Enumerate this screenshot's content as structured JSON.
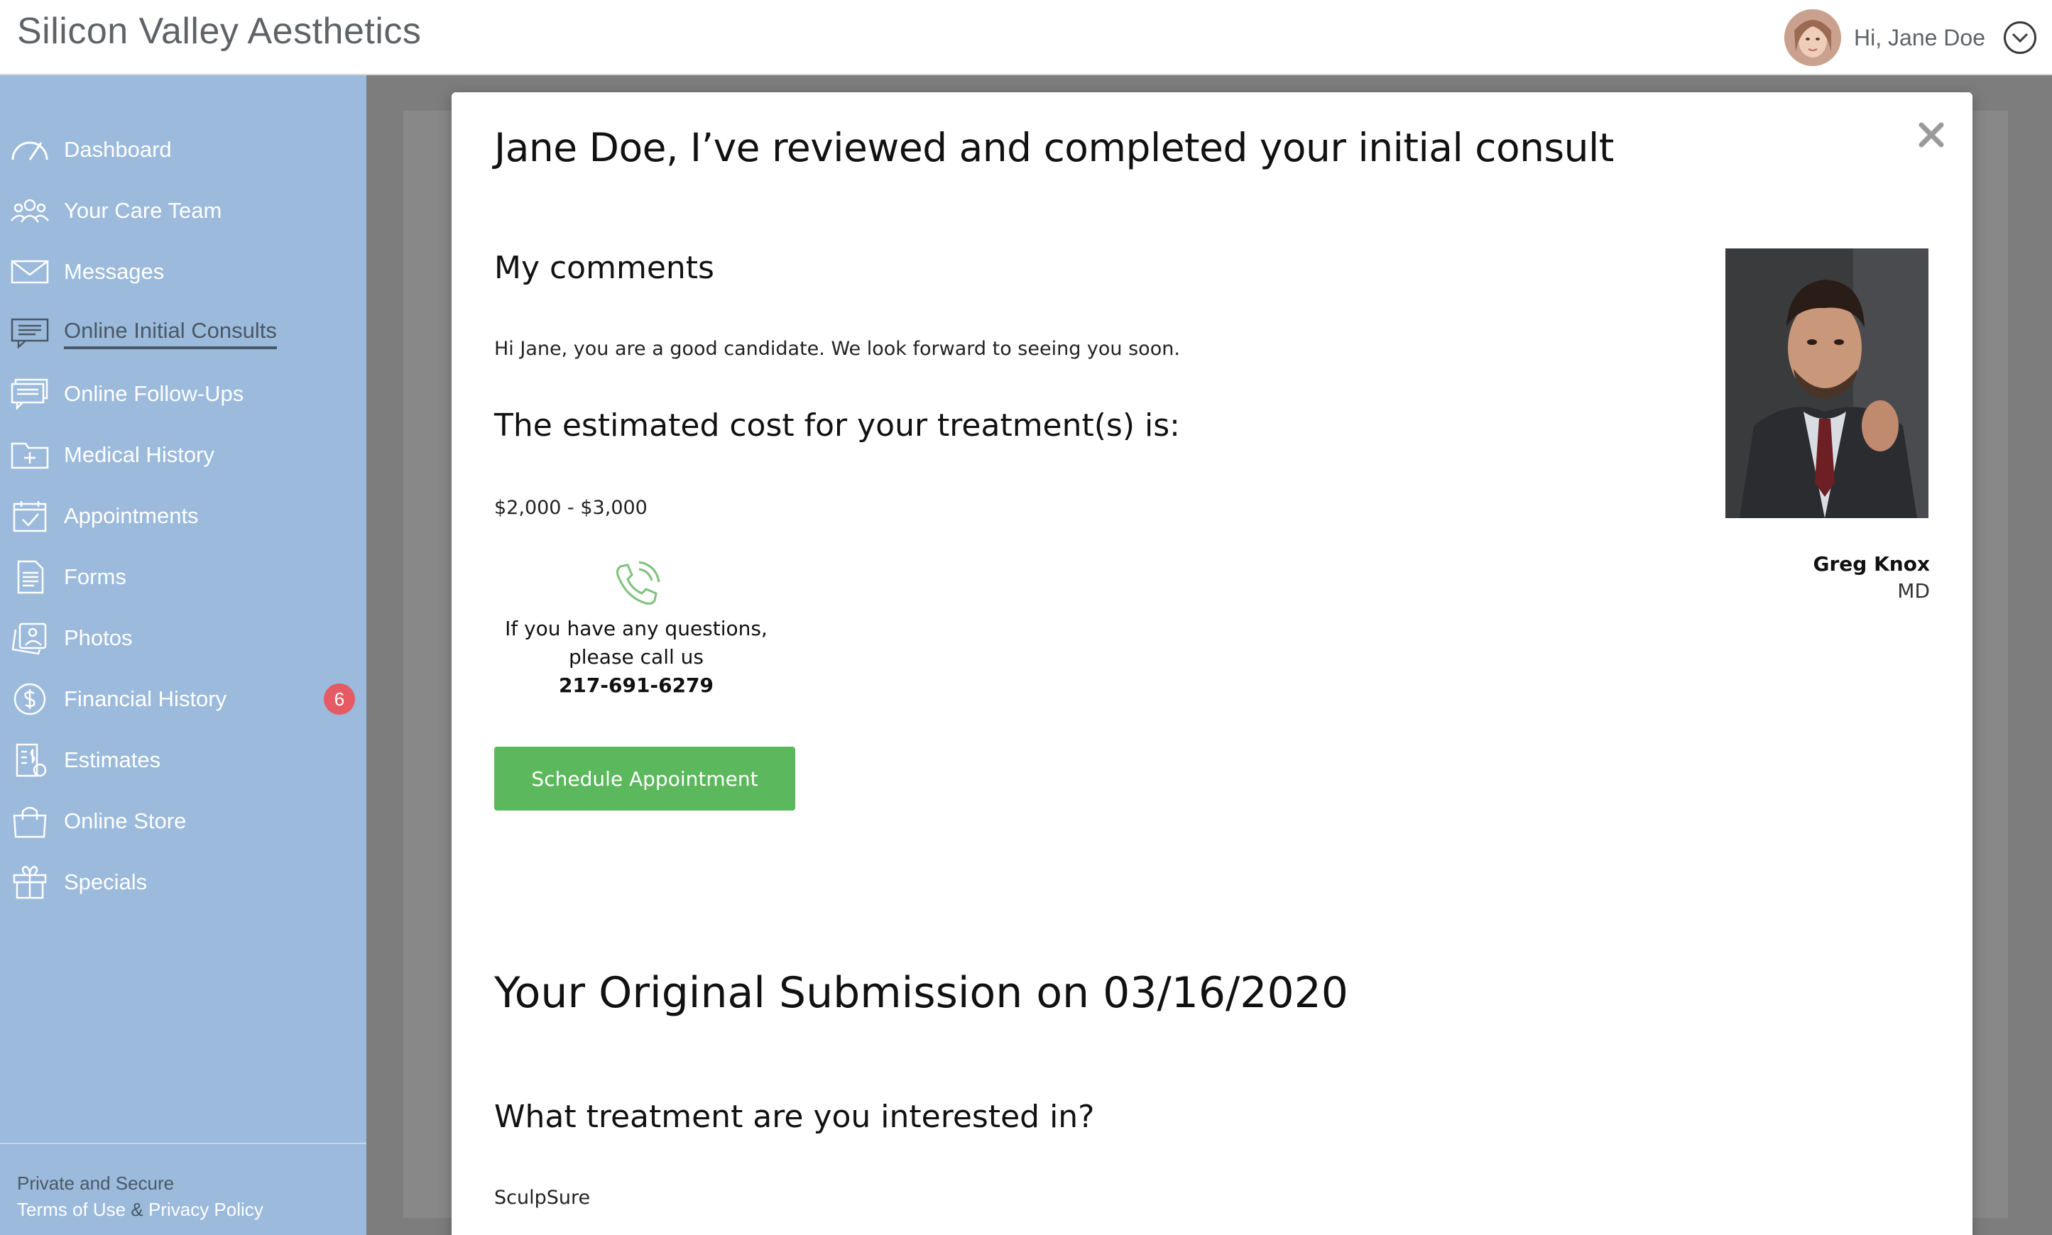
{
  "header": {
    "brand": "Silicon Valley Aesthetics",
    "greeting": "Hi, Jane Doe"
  },
  "sidebar": {
    "items": [
      {
        "label": "Dashboard",
        "icon": "gauge-icon"
      },
      {
        "label": "Your Care Team",
        "icon": "team-icon"
      },
      {
        "label": "Messages",
        "icon": "envelope-icon"
      },
      {
        "label": "Online Initial Consults",
        "icon": "chat-bubble-icon",
        "active": true
      },
      {
        "label": "Online Follow-Ups",
        "icon": "chat-bubbles-icon"
      },
      {
        "label": "Medical History",
        "icon": "medical-folder-icon"
      },
      {
        "label": "Appointments",
        "icon": "calendar-check-icon"
      },
      {
        "label": "Forms",
        "icon": "document-icon"
      },
      {
        "label": "Photos",
        "icon": "photos-icon"
      },
      {
        "label": "Financial History",
        "icon": "dollar-icon",
        "badge": "6"
      },
      {
        "label": "Estimates",
        "icon": "estimate-icon"
      },
      {
        "label": "Online Store",
        "icon": "shopping-bag-icon"
      },
      {
        "label": "Specials",
        "icon": "gift-icon"
      }
    ],
    "footer": {
      "private_secure": "Private and Secure",
      "terms": "Terms of Use",
      "amp": "&",
      "privacy": "Privacy Policy"
    }
  },
  "modal": {
    "title": "Jane Doe, I’ve reviewed and completed your initial consult",
    "comments_heading": "My comments",
    "comments_text": "Hi Jane, you are a good candidate. We look forward to seeing you soon.",
    "cost_heading": "The estimated cost for your treatment(s) is:",
    "cost_value": "$2,000 - $3,000",
    "phone_line1": "If you have any questions,",
    "phone_line2": "please call us",
    "phone_number": "217-691-6279",
    "schedule_button": "Schedule Appointment",
    "doctor_name": "Greg Knox",
    "doctor_title": "MD",
    "submission_heading": "Your Original Submission on 03/16/2020",
    "question_heading": "What treatment are you interested in?",
    "answer": "SculpSure"
  },
  "colors": {
    "sidebar_bg": "#9bbadc",
    "accent_green": "#5cb85c",
    "badge_red": "#e65a64"
  }
}
